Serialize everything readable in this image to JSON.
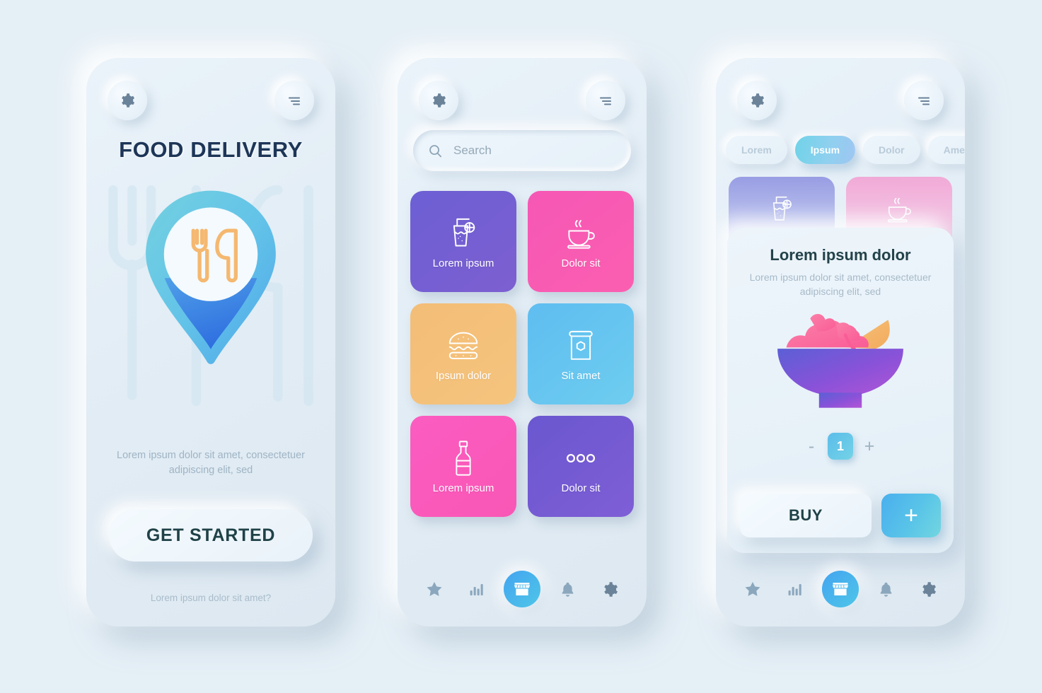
{
  "background_color": "#e5eff6",
  "screens": [
    {
      "id": "onboarding",
      "header": {
        "gear_icon": "gear-icon",
        "menu_icon": "hamburger-menu-icon"
      },
      "title": "FOOD DELIVERY",
      "hero_icon": "location-pin-fork-knife-icon",
      "subtitle": "Lorem ipsum dolor sit amet, consectetuer adipiscing elit, sed",
      "cta_label": "GET STARTED",
      "footer_link": "Lorem ipsum dolor sit amet?"
    },
    {
      "id": "catalog",
      "header": {
        "gear_icon": "gear-icon",
        "menu_icon": "hamburger-menu-icon"
      },
      "search": {
        "placeholder": "Search",
        "icon": "search-icon"
      },
      "tiles": [
        {
          "label": "Lorem ipsum",
          "icon": "drink-glass-icon",
          "color_start": "#6c5fd4",
          "color_end": "#7d5fd0"
        },
        {
          "label": "Dolor sit",
          "icon": "coffee-cup-icon",
          "color_start": "#f557b5",
          "color_end": "#fb5fb0"
        },
        {
          "label": "Ipsum dolor",
          "icon": "burger-icon",
          "color_start": "#f3bd77",
          "color_end": "#f5c178"
        },
        {
          "label": "Sit amet",
          "icon": "food-bag-icon",
          "color_start": "#5fbdf0",
          "color_end": "#6ec9ef"
        },
        {
          "label": "Lorem ipsum",
          "icon": "bottle-icon",
          "color_start": "#fb5cc0",
          "color_end": "#f957b6"
        },
        {
          "label": "Dolor sit",
          "icon": "three-dots-icon",
          "color_start": "#6a57cf",
          "color_end": "#7f5ed6"
        }
      ],
      "nav": [
        {
          "icon": "star-icon",
          "active": false
        },
        {
          "icon": "bar-chart-icon",
          "active": false
        },
        {
          "icon": "storefront-icon",
          "active": true
        },
        {
          "icon": "bell-icon",
          "active": false
        },
        {
          "icon": "gear-icon",
          "active": false
        }
      ]
    },
    {
      "id": "product",
      "header": {
        "gear_icon": "gear-icon",
        "menu_icon": "hamburger-menu-icon"
      },
      "chips": [
        {
          "label": "Lorem",
          "active": false
        },
        {
          "label": "Ipsum",
          "active": true
        },
        {
          "label": "Dolor",
          "active": false
        },
        {
          "label": "Amet",
          "active": false
        }
      ],
      "background_tiles": [
        {
          "icon": "drink-glass-icon",
          "color_start": "#8b8fe0",
          "color_end": "#cfd8f4"
        },
        {
          "icon": "coffee-cup-icon",
          "color_start": "#f49ed2",
          "color_end": "#f7d3ea"
        }
      ],
      "card": {
        "title": "Lorem ipsum dolor",
        "description": "Lorem ipsum dolor sit amet, consectetuer adipiscing elit, sed",
        "product_icon": "salad-bowl-icon",
        "stepper": {
          "decrement": "-",
          "quantity": "1",
          "increment": "+"
        },
        "buy_label": "BUY",
        "add_label": "+"
      },
      "nav": [
        {
          "icon": "star-icon",
          "active": false
        },
        {
          "icon": "bar-chart-icon",
          "active": false
        },
        {
          "icon": "storefront-icon",
          "active": true
        },
        {
          "icon": "bell-icon",
          "active": false
        },
        {
          "icon": "gear-icon",
          "active": false
        }
      ]
    }
  ],
  "colors": {
    "accent_blue_start": "#43a4f0",
    "accent_blue_end": "#4fc6e8",
    "title_navy": "#1d3557",
    "muted_text": "#a7bac9"
  }
}
